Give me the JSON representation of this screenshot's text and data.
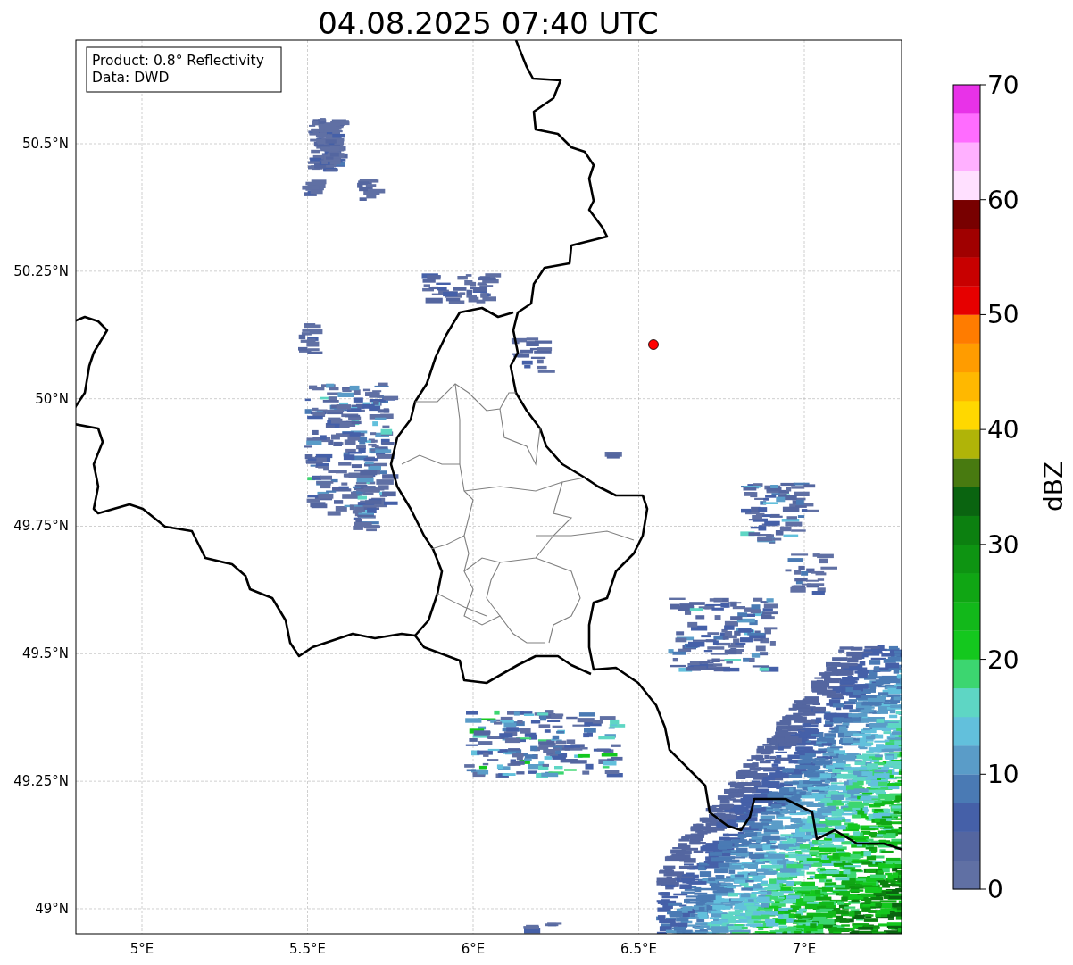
{
  "title": "04.08.2025 07:40 UTC",
  "info_box": [
    "Product: 0.8° Reflectivity",
    "Data: DWD"
  ],
  "map": {
    "x_ticks": [
      "5°E",
      "5.5°E",
      "6°E",
      "6.5°E",
      "7°E"
    ],
    "y_ticks": [
      "50.5°N",
      "50.25°N",
      "50°N",
      "49.75°N",
      "49.5°N",
      "49.25°N",
      "49°N"
    ]
  },
  "colorbar": {
    "label": "dBZ",
    "ticks": [
      "70",
      "60",
      "50",
      "40",
      "30",
      "20",
      "10",
      "0"
    ],
    "bands": [
      {
        "color": "#6070a4"
      },
      {
        "color": "#5466a0"
      },
      {
        "color": "#4560a8"
      },
      {
        "color": "#4a7ab4"
      },
      {
        "color": "#5a9cc8"
      },
      {
        "color": "#62c0dc"
      },
      {
        "color": "#5ed6c4"
      },
      {
        "color": "#3cd670"
      },
      {
        "color": "#14c81e"
      },
      {
        "color": "#12b81a"
      },
      {
        "color": "#10a614"
      },
      {
        "color": "#0e9412"
      },
      {
        "color": "#0c8010"
      },
      {
        "color": "#0a6410"
      },
      {
        "color": "#487a10"
      },
      {
        "color": "#b0b408"
      },
      {
        "color": "#ffd800"
      },
      {
        "color": "#ffb800"
      },
      {
        "color": "#ff9c00"
      },
      {
        "color": "#ff7c00"
      },
      {
        "color": "#e60000"
      },
      {
        "color": "#c80000"
      },
      {
        "color": "#a00000"
      },
      {
        "color": "#780000"
      },
      {
        "color": "#ffe0ff"
      },
      {
        "color": "#ffb0ff"
      },
      {
        "color": "#ff6cff"
      },
      {
        "color": "#e832e8"
      }
    ]
  }
}
